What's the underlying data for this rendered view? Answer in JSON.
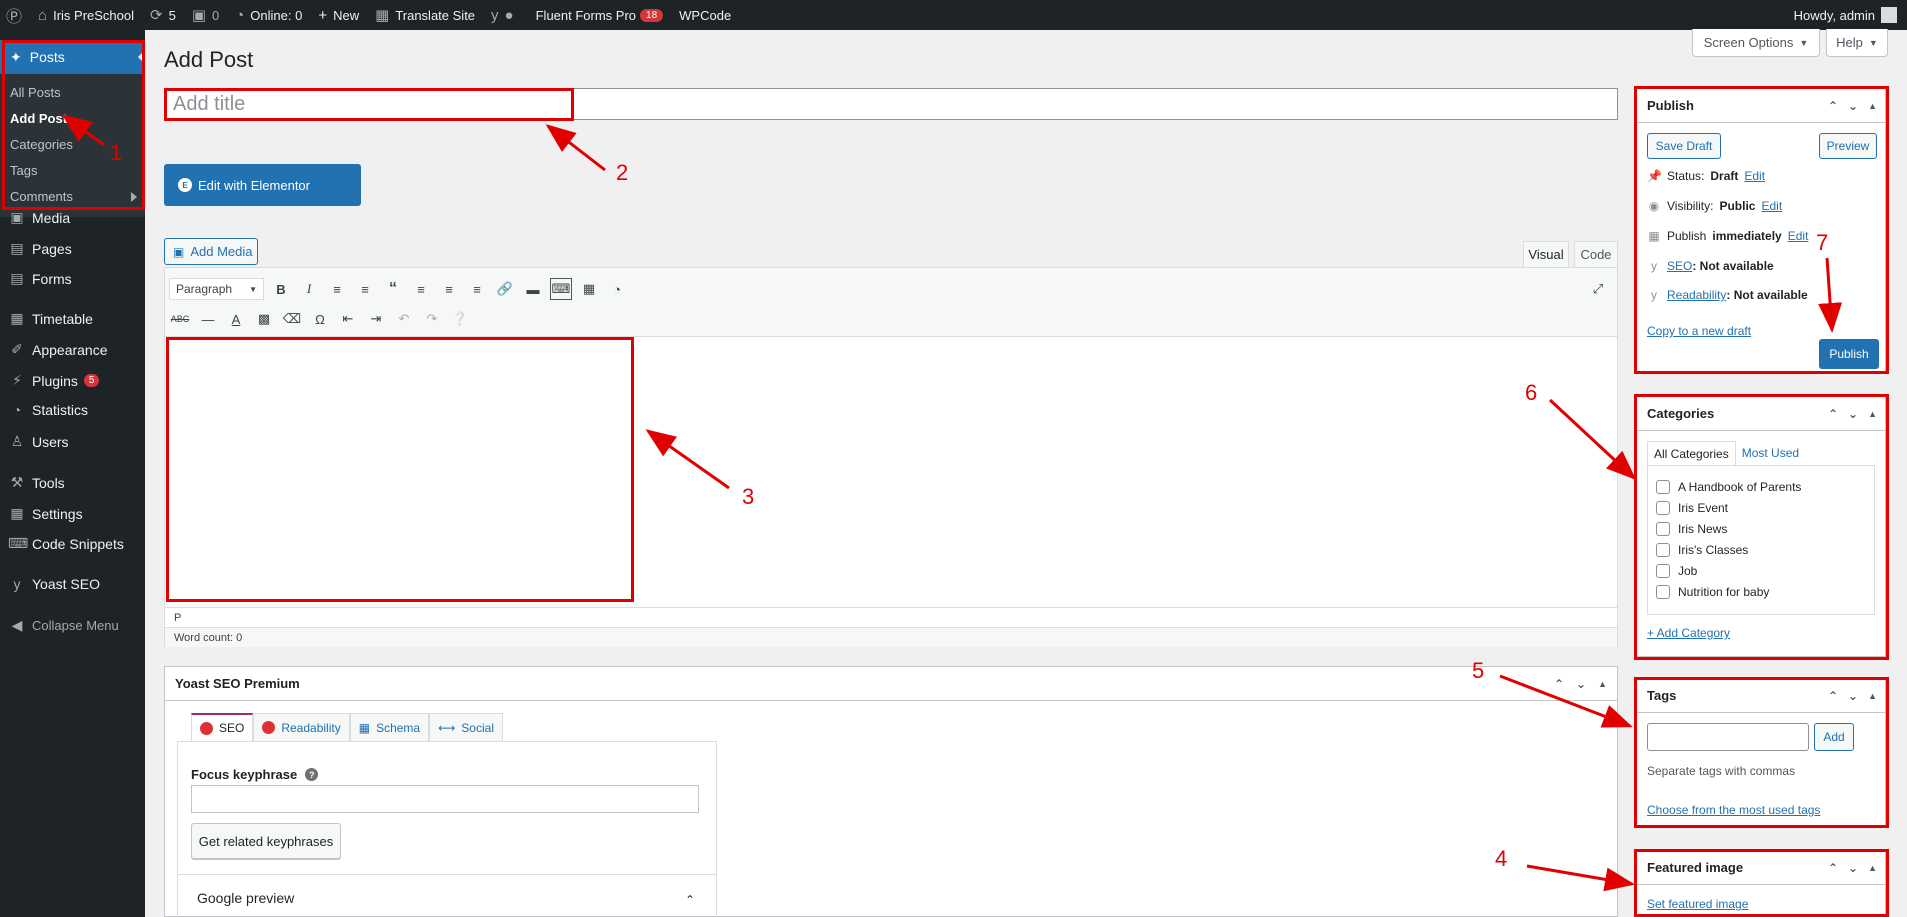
{
  "adminbar": {
    "site_name": "Iris PreSchool",
    "updates_count": "5",
    "comments_count": "0",
    "online": "Online: 0",
    "new": "New",
    "translate": "Translate Site",
    "fluent_forms": "Fluent Forms Pro",
    "fluent_badge": "18",
    "wpcode": "WPCode",
    "howdy": "Howdy, admin"
  },
  "sidebar": {
    "current": "Posts",
    "submenu": [
      "All Posts",
      "Add Post",
      "Categories",
      "Tags",
      "Comments"
    ],
    "items": [
      {
        "label": "Media",
        "icon": "media-icon"
      },
      {
        "label": "Pages",
        "icon": "pages-icon"
      },
      {
        "label": "Forms",
        "icon": "forms-icon"
      },
      {
        "label": "Timetable",
        "icon": "calendar-icon"
      },
      {
        "label": "Appearance",
        "icon": "brush-icon"
      },
      {
        "label": "Plugins",
        "icon": "plugin-icon",
        "badge": "5"
      },
      {
        "label": "Statistics",
        "icon": "pie-icon"
      },
      {
        "label": "Users",
        "icon": "user-icon"
      },
      {
        "label": "Tools",
        "icon": "wrench-icon"
      },
      {
        "label": "Settings",
        "icon": "settings-icon"
      },
      {
        "label": "Code Snippets",
        "icon": "code-icon"
      },
      {
        "label": "Yoast SEO",
        "icon": "yoast-icon"
      },
      {
        "label": "Collapse Menu",
        "icon": "collapse-icon"
      }
    ]
  },
  "header": {
    "title": "Add Post",
    "screen_options": "Screen Options",
    "help": "Help"
  },
  "editor": {
    "title_placeholder": "Add title",
    "elementor": "Edit with Elementor",
    "add_media": "Add Media",
    "tab_visual": "Visual",
    "tab_code": "Code",
    "format_select": "Paragraph",
    "path": "P",
    "word_count": "Word count: 0"
  },
  "yoast": {
    "title": "Yoast SEO Premium",
    "tabs": [
      "SEO",
      "Readability",
      "Schema",
      "Social"
    ],
    "focus_label": "Focus keyphrase",
    "related_button": "Get related keyphrases",
    "google_preview": "Google preview"
  },
  "publish": {
    "title": "Publish",
    "save_draft": "Save Draft",
    "preview": "Preview",
    "status_label": "Status:",
    "status_value": "Draft",
    "visibility_label": "Visibility:",
    "visibility_value": "Public",
    "publish_label": "Publish",
    "publish_value": "immediately",
    "edit": "Edit",
    "seo_link": "SEO",
    "readability_link": "Readability",
    "not_available": ": Not available",
    "copy_draft": "Copy to a new draft",
    "publish_button": "Publish"
  },
  "categories": {
    "title": "Categories",
    "tab_all": "All Categories",
    "tab_most": "Most Used",
    "items": [
      "A Handbook of Parents",
      "Iris Event",
      "Iris News",
      "Iris's Classes",
      "Job",
      "Nutrition for baby"
    ],
    "add": "+ Add Category"
  },
  "tags": {
    "title": "Tags",
    "add": "Add",
    "hint": "Separate tags with commas",
    "choose": "Choose from the most used tags"
  },
  "featured": {
    "title": "Featured image",
    "set": "Set featured image"
  },
  "annotations": [
    "1",
    "2",
    "3",
    "4",
    "5",
    "6",
    "7"
  ],
  "colors": {
    "accent": "#2271b1",
    "annotation": "#e00000",
    "adminbar": "#1d2327"
  }
}
